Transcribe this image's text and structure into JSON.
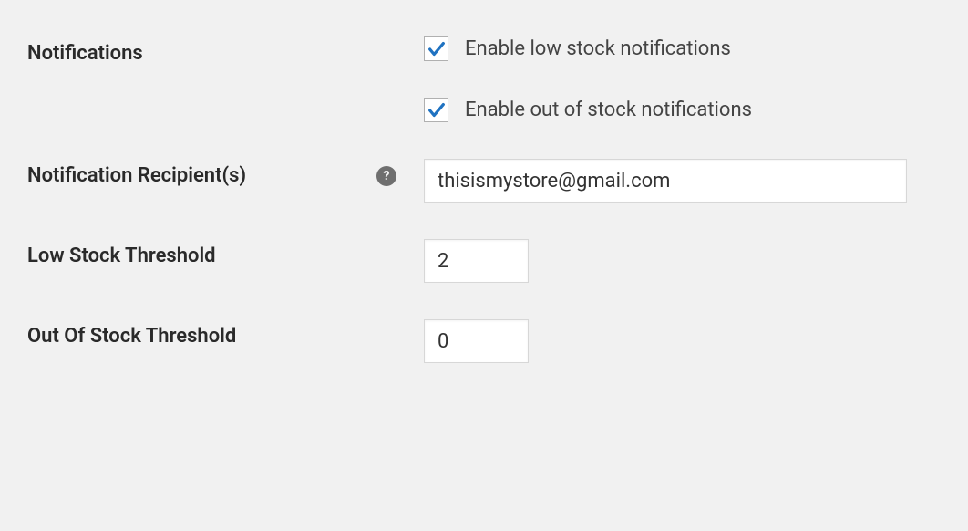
{
  "notifications": {
    "label": "Notifications",
    "low_stock_checkbox_label": "Enable low stock notifications",
    "low_stock_checked": true,
    "out_of_stock_checkbox_label": "Enable out of stock notifications",
    "out_of_stock_checked": true
  },
  "recipients": {
    "label": "Notification Recipient(s)",
    "value": "thisismystore@gmail.com",
    "help_icon_glyph": "?"
  },
  "low_stock_threshold": {
    "label": "Low Stock Threshold",
    "value": "2"
  },
  "out_of_stock_threshold": {
    "label": "Out Of Stock Threshold",
    "value": "0"
  },
  "colors": {
    "checkmark": "#1f72c1",
    "background": "#f1f1f1"
  }
}
